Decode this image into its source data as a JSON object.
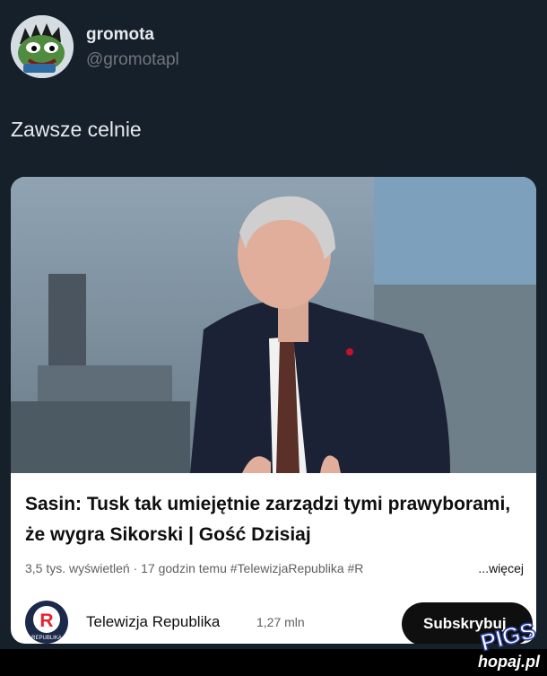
{
  "tweet": {
    "author_name": "gromota",
    "author_handle": "@gromotapl",
    "text": "Zawsze celnie"
  },
  "video_card": {
    "title": "Sasin: Tusk tak umiejętnie zarządzi tymi prawyborami, że wygra Sikorski | Gość Dzisiaj",
    "meta": "3,5 tys. wyświetleń · 17 godzin temu  #TelewizjaRepublika #R",
    "more_label": "...więcej",
    "channel_name": "Telewizja Republika",
    "channel_subs": "1,27 mln",
    "subscribe_label": "Subskrybuj",
    "channel_logo_text": "REPUBLIKA"
  },
  "watermark": {
    "text": "hopaj.pl",
    "logo_text": "PIGS"
  },
  "colors": {
    "background": "#15202b",
    "primary_text": "#e7e9ea",
    "secondary_text": "#71767b",
    "republika_red": "#e8222f",
    "subscribe_button": "#0f0f0f"
  },
  "icons": [
    "avatar-frog-icon",
    "republika-logo-icon"
  ]
}
